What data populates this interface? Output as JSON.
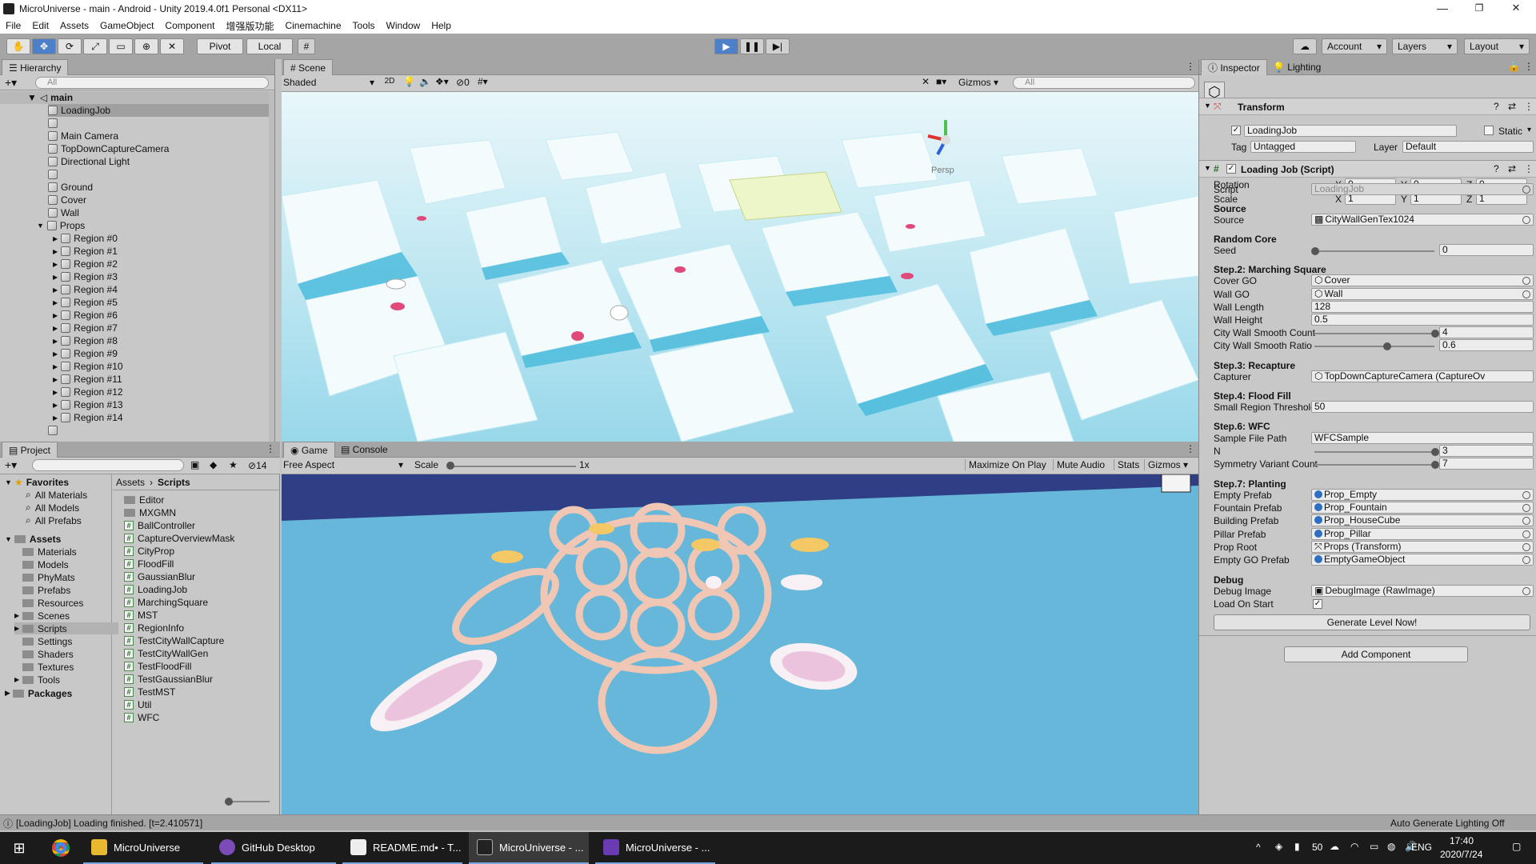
{
  "window": {
    "title": "MicroUniverse - main - Android - Unity 2019.4.0f1 Personal <DX11>",
    "minimize": "—",
    "maximize": "❐",
    "close": "✕"
  },
  "menu": [
    "File",
    "Edit",
    "Assets",
    "GameObject",
    "Component",
    "增强版功能",
    "Cinemachine",
    "Tools",
    "Window",
    "Help"
  ],
  "toolbar": {
    "pivot": "Pivot",
    "local": "Local",
    "account": "Account",
    "layers": "Layers",
    "layout": "Layout"
  },
  "hierarchy": {
    "tab": "Hierarchy",
    "search_placeholder": "All",
    "scene": "main",
    "items": [
      "LoadingJob",
      "",
      "Main Camera",
      "TopDownCaptureCamera",
      "Directional Light",
      "",
      "Ground",
      "Cover",
      "Wall",
      "Props"
    ],
    "regions": [
      "Region #0",
      "Region #1",
      "Region #2",
      "Region #3",
      "Region #4",
      "Region #5",
      "Region #6",
      "Region #7",
      "Region #8",
      "Region #9",
      "Region #10",
      "Region #11",
      "Region #12",
      "Region #13",
      "Region #14"
    ]
  },
  "scene": {
    "tab": "Scene",
    "shading": "Shaded",
    "mode_2d": "2D",
    "fx_count": "0",
    "gizmos": "Gizmos",
    "search_placeholder": "All",
    "persp": "Persp"
  },
  "project": {
    "tab": "Project",
    "badge": "14",
    "favorites_label": "Favorites",
    "favorites": [
      "All Materials",
      "All Models",
      "All Prefabs"
    ],
    "assets_label": "Assets",
    "asset_folders": [
      "Materials",
      "Models",
      "PhyMats",
      "Prefabs",
      "Resources",
      "Scenes",
      "Scripts",
      "Settings",
      "Shaders",
      "Textures",
      "Tools"
    ],
    "packages_label": "Packages",
    "breadcrumb_root": "Assets",
    "breadcrumb_current": "Scripts",
    "files": [
      {
        "name": "Editor",
        "kind": "folder"
      },
      {
        "name": "MXGMN",
        "kind": "folder"
      },
      {
        "name": "BallController",
        "kind": "script"
      },
      {
        "name": "CaptureOverviewMask",
        "kind": "script"
      },
      {
        "name": "CityProp",
        "kind": "script"
      },
      {
        "name": "FloodFill",
        "kind": "script"
      },
      {
        "name": "GaussianBlur",
        "kind": "script"
      },
      {
        "name": "LoadingJob",
        "kind": "script"
      },
      {
        "name": "MarchingSquare",
        "kind": "script"
      },
      {
        "name": "MST",
        "kind": "script"
      },
      {
        "name": "RegionInfo",
        "kind": "script"
      },
      {
        "name": "TestCityWallCapture",
        "kind": "script"
      },
      {
        "name": "TestCityWallGen",
        "kind": "script"
      },
      {
        "name": "TestFloodFill",
        "kind": "script"
      },
      {
        "name": "TestGaussianBlur",
        "kind": "script"
      },
      {
        "name": "TestMST",
        "kind": "script"
      },
      {
        "name": "Util",
        "kind": "script"
      },
      {
        "name": "WFC",
        "kind": "script"
      }
    ]
  },
  "game": {
    "tab": "Game",
    "console_tab": "Console",
    "aspect": "Free Aspect",
    "scale_label": "Scale",
    "scale_value": "1x",
    "maximize": "Maximize On Play",
    "mute": "Mute Audio",
    "stats": "Stats",
    "gizmos": "Gizmos"
  },
  "inspector": {
    "tab": "Inspector",
    "lighting_tab": "Lighting",
    "object_name": "LoadingJob",
    "static_label": "Static",
    "tag_label": "Tag",
    "tag_value": "Untagged",
    "layer_label": "Layer",
    "layer_value": "Default",
    "transform": {
      "title": "Transform",
      "position_label": "Position",
      "rotation_label": "Rotation",
      "scale_label": "Scale",
      "position": [
        "0",
        "0",
        "0"
      ],
      "rotation": [
        "0",
        "0",
        "0"
      ],
      "scale": [
        "1",
        "1",
        "1"
      ]
    },
    "script_component": {
      "title": "Loading Job (Script)",
      "script_label": "Script",
      "script_value": "LoadingJob",
      "source_header": "Source",
      "source_label": "Source",
      "source_value": "CityWallGenTex1024",
      "random_header": "Random Core",
      "seed_label": "Seed",
      "seed_value": "0",
      "step2_header": "Step.2: Marching Square",
      "cover_label": "Cover GO",
      "cover_value": "Cover",
      "wall_label": "Wall GO",
      "wall_value": "Wall",
      "wall_length_label": "Wall Length",
      "wall_length_value": "128",
      "wall_height_label": "Wall Height",
      "wall_height_value": "0.5",
      "smooth_count_label": "City Wall Smooth Count",
      "smooth_count_value": "4",
      "smooth_ratio_label": "City Wall Smooth Ratio",
      "smooth_ratio_value": "0.6",
      "step3_header": "Step.3: Recapture",
      "capturer_label": "Capturer",
      "capturer_value": "TopDownCaptureCamera (CaptureOv",
      "step4_header": "Step.4: Flood Fill",
      "small_region_label": "Small Region Threshold",
      "small_region_value": "50",
      "step6_header": "Step.6: WFC",
      "sample_path_label": "Sample File Path",
      "sample_path_value": "WFCSample",
      "n_label": "N",
      "n_value": "3",
      "symmetry_label": "Symmetry Variant Count",
      "symmetry_value": "7",
      "step7_header": "Step.7: Planting",
      "empty_prefab_label": "Empty Prefab",
      "empty_prefab_value": "Prop_Empty",
      "fountain_label": "Fountain Prefab",
      "fountain_value": "Prop_Fountain",
      "building_label": "Building Prefab",
      "building_value": "Prop_HouseCube",
      "pillar_label": "Pillar Prefab",
      "pillar_value": "Prop_Pillar",
      "prop_root_label": "Prop Root",
      "prop_root_value": "Props (Transform)",
      "empty_go_label": "Empty GO Prefab",
      "empty_go_value": "EmptyGameObject",
      "debug_header": "Debug",
      "debug_image_label": "Debug Image",
      "debug_image_value": "DebugImage (RawImage)",
      "load_on_start_label": "Load On Start",
      "generate_button": "Generate Level Now!"
    },
    "add_component": "Add Component"
  },
  "status": {
    "message": "[LoadingJob] Loading finished. [t=2.410571]",
    "lighting": "Auto Generate Lighting Off"
  },
  "taskbar": {
    "apps": [
      "MicroUniverse",
      "GitHub Desktop",
      "README.md• - T...",
      "MicroUniverse - ...",
      "MicroUniverse - ..."
    ],
    "battery": "50",
    "lang": "ENG",
    "time": "17:40",
    "date": "2020/7/24"
  }
}
